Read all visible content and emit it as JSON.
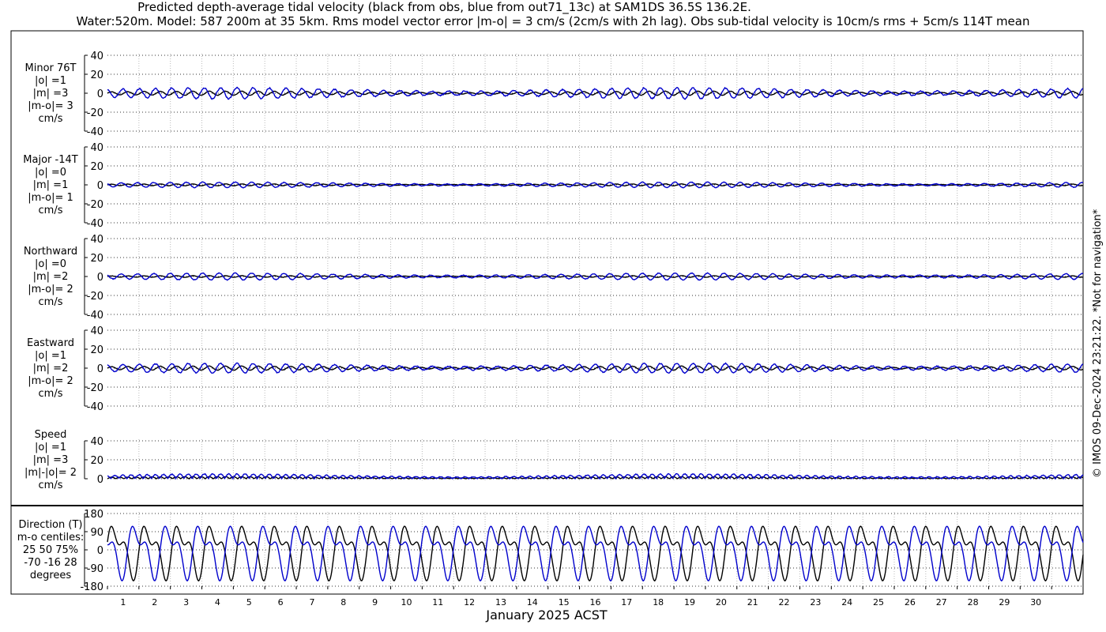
{
  "title_line1": "Predicted depth-average tidal velocity (black from obs, blue from out71_13c) at SAM1DS 36.5S 136.2E.",
  "title_line2": "Water:520m. Model: 587 200m at 35 5km. Rms model vector error |m-o| = 3 cm/s (2cm/s with 2h lag). Obs sub-tidal velocity is 10cm/s rms + 5cm/s 114T mean",
  "side_note": "© IMOS 09-Dec-2024 23:21:22. *Not for navigation*",
  "colors": {
    "obs": "#000000",
    "model": "#0000cc",
    "grid": "#bbbbbb"
  },
  "chart_data": [
    {
      "type": "line",
      "id": "minor",
      "label_lines": [
        "Minor 76T",
        "|o| =1",
        "|m| =3",
        "|m-o|= 3",
        "cm/s"
      ],
      "yticks": [
        40,
        20,
        0,
        -20,
        -40
      ],
      "ylim": [
        -40,
        40
      ],
      "xlim": [
        0,
        31
      ],
      "series": [
        {
          "amplitude": 1.5,
          "phase": 0.0,
          "noise": 0.4
        },
        {
          "amplitude": 4.0,
          "phase": 0.3,
          "noise": 1.2
        }
      ]
    },
    {
      "type": "line",
      "id": "major",
      "label_lines": [
        "Major -14T",
        "|o| =0",
        "|m| =1",
        "|m-o|= 1",
        "cm/s"
      ],
      "yticks": [
        40,
        20,
        0,
        -20,
        -40
      ],
      "ylim": [
        -40,
        40
      ],
      "xlim": [
        0,
        31
      ],
      "series": [
        {
          "amplitude": 0.7,
          "phase": 0.0,
          "noise": 0.3
        },
        {
          "amplitude": 2.0,
          "phase": 0.4,
          "noise": 0.6
        }
      ]
    },
    {
      "type": "line",
      "id": "north",
      "label_lines": [
        "Northward",
        "|o| =0",
        "|m| =2",
        "|m-o|= 2",
        "cm/s"
      ],
      "yticks": [
        40,
        20,
        0,
        -20,
        -40
      ],
      "ylim": [
        -40,
        40
      ],
      "xlim": [
        0,
        31
      ],
      "series": [
        {
          "amplitude": 0.6,
          "phase": 0.0,
          "noise": 0.3
        },
        {
          "amplitude": 2.5,
          "phase": 0.4,
          "noise": 0.7
        }
      ]
    },
    {
      "type": "line",
      "id": "east",
      "label_lines": [
        "Eastward",
        "|o| =1",
        "|m| =2",
        "|m-o|= 2",
        "cm/s"
      ],
      "yticks": [
        40,
        20,
        0,
        -20,
        -40
      ],
      "ylim": [
        -40,
        40
      ],
      "xlim": [
        0,
        31
      ],
      "series": [
        {
          "amplitude": 1.5,
          "phase": 0.0,
          "noise": 0.4
        },
        {
          "amplitude": 3.5,
          "phase": 0.3,
          "noise": 1.0
        }
      ]
    },
    {
      "type": "line",
      "id": "speed",
      "label_lines": [
        "Speed",
        "|o| =1",
        "|m| =3",
        "|m|-|o|= 2",
        "cm/s"
      ],
      "yticks": [
        40,
        20,
        0
      ],
      "ylim": [
        0,
        40
      ],
      "xlim": [
        0,
        31
      ],
      "series": [
        {
          "amplitude": 1.5,
          "phase": 0.0,
          "noise": 0.3,
          "abs": true
        },
        {
          "amplitude": 3.5,
          "phase": 0.3,
          "noise": 0.8,
          "abs": true
        }
      ]
    },
    {
      "type": "line",
      "id": "direction",
      "label_lines": [
        "Direction (T)",
        "m-o centiles:",
        "25  50  75%",
        "-70 -16  28",
        "degrees"
      ],
      "yticks": [
        180,
        90,
        0,
        -90,
        -180
      ],
      "ylim": [
        -180,
        180
      ],
      "xlim": [
        0,
        31
      ],
      "xticks": [
        1,
        2,
        3,
        4,
        5,
        6,
        7,
        8,
        9,
        10,
        11,
        12,
        13,
        14,
        15,
        16,
        17,
        18,
        19,
        20,
        21,
        22,
        23,
        24,
        25,
        26,
        27,
        28,
        29,
        30
      ],
      "xlabel": "January 2025 ACST",
      "series": [
        {
          "kind": "direction",
          "phase": 0.0
        },
        {
          "kind": "direction",
          "phase": 0.35
        }
      ]
    }
  ]
}
